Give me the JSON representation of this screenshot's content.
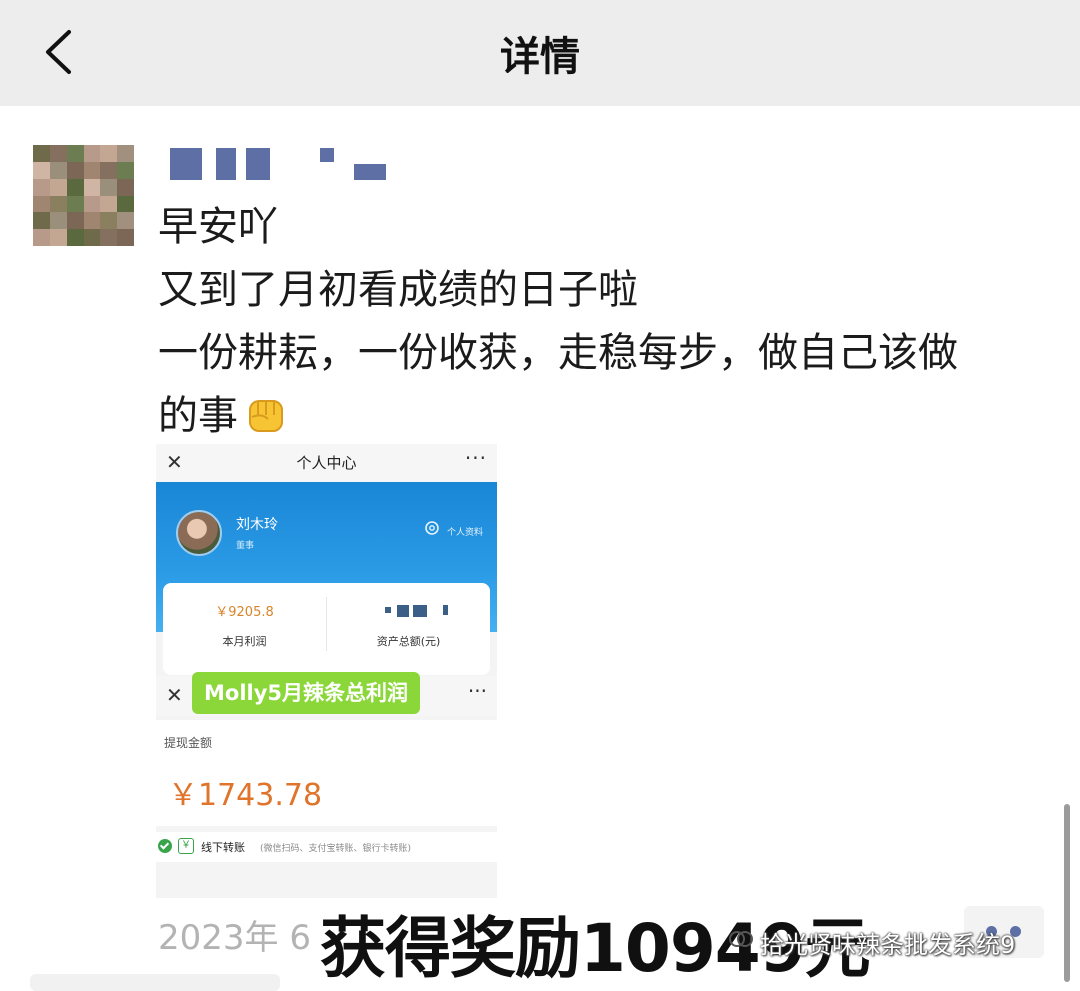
{
  "navbar": {
    "title": "详情",
    "back_icon": "chevron-left-icon"
  },
  "post": {
    "lines": [
      "早安吖",
      "又到了月初看成绩的日子啦",
      "一份耕耘，一份收获，走稳每步，做自己该做",
      "的事"
    ],
    "emoji": "raised-fist-icon",
    "date": "2023年 6",
    "comment_icon": "more-dots-icon"
  },
  "screenshot": {
    "title": "个人中心",
    "close_icon": "close-icon",
    "more_icon": "more-dots-icon",
    "user_name": "刘木玲",
    "user_role": "董事",
    "profile_label": "个人资料",
    "monthly_profit": "￥9205.8",
    "monthly_profit_label": "本月利润",
    "total_assets_label": "资产总额(元)",
    "tag": "Molly5月辣条总利润",
    "withdraw_label": "提现金额",
    "withdraw_amount": "￥1743.78",
    "offline_label": "线下转账",
    "offline_note": "(微信扫码、支付宝转账、银行卡转账)",
    "yuan_symbol": "￥"
  },
  "overlay": {
    "reward_text": "获得奖励10949元",
    "watermark": "拾光贤味辣条批发系统9"
  },
  "colors": {
    "navbar_bg": "#ededed",
    "nickname": "#5d6fa5",
    "hero_blue": "#1a86d6",
    "profit_orange": "#d7852b",
    "amount_orange": "#e0742b",
    "tag_green": "#8bd73a",
    "date_gray": "#b3b3b3"
  }
}
